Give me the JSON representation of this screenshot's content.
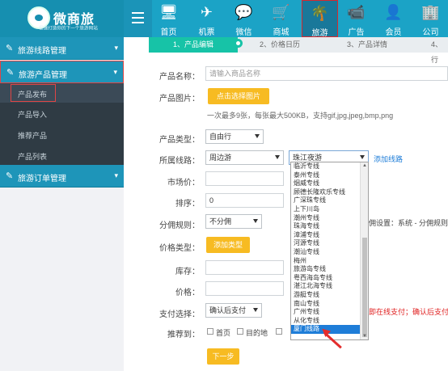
{
  "brand": {
    "name": "微商旅",
    "subtitle": "极速打造你的下一个旅游网站"
  },
  "top_nav": [
    {
      "label": "首页",
      "icon": "monitor-icon"
    },
    {
      "label": "机票",
      "icon": "airplane-icon"
    },
    {
      "label": "微信",
      "icon": "wechat-icon"
    },
    {
      "label": "商城",
      "icon": "cart-icon"
    },
    {
      "label": "旅游",
      "icon": "palm-tree-icon"
    },
    {
      "label": "广告",
      "icon": "video-icon"
    },
    {
      "label": "会员",
      "icon": "member-icon"
    },
    {
      "label": "公司",
      "icon": "company-icon"
    }
  ],
  "sidebar": {
    "groups": [
      {
        "label": "旅游线路管理"
      },
      {
        "label": "旅游产品管理"
      },
      {
        "label": "旅游订单管理"
      }
    ],
    "sub_items": [
      {
        "label": "产品发布"
      },
      {
        "label": "产品导入"
      },
      {
        "label": "推荐产品"
      },
      {
        "label": "产品列表"
      }
    ]
  },
  "steps": [
    {
      "label": "1、产品编辑"
    },
    {
      "label": "2、价格日历"
    },
    {
      "label": "3、产品详情"
    },
    {
      "label": "4、行"
    }
  ],
  "form": {
    "product_name_label": "产品名称：",
    "product_name_placeholder": "请输入商品名称",
    "product_image_label": "产品图片：",
    "choose_image_button": "点击选择图片",
    "image_hint": "一次最多9张，每张最大500KB，支持gif,jpg,jpeg,bmp,png",
    "product_type_label": "产品类型：",
    "product_type_value": "自由行",
    "route_label": "所属线路：",
    "route_select1": "周边游",
    "route_select2": "珠江夜游",
    "add_route_link": "添加线路",
    "market_price_label": "市场价：",
    "sort_label": "排序：",
    "sort_value": "0",
    "commission_label": "分佣规则：",
    "commission_value": "不分佣",
    "commission_hint": "佣设置：系统 - 分佣规则",
    "price_type_label": "价格类型：",
    "add_type_button": "添加类型",
    "stock_label": "库存：",
    "price_label": "价格：",
    "payment_label": "支付选择：",
    "payment_value": "确认后支付",
    "payment_hint": "即在线支付；确认后支付",
    "recommend_label": "推荐到：",
    "recommend_option1": "首页",
    "recommend_option2": "目的地",
    "next_button": "下一步"
  },
  "route_dropdown": [
    "临沂专线",
    "泰州专线",
    "烟威专线",
    "顾德长隆欢乐专线",
    "广深珠专线",
    "上下川岛",
    "潮州专线",
    "珠海专线",
    "漳浦专线",
    "河源专线",
    "潮汕专线",
    "梅州",
    "旅游岛专线",
    "粤西海岛专线",
    "湛江北海专线",
    "游艇专线",
    "南山专线",
    "广州专线",
    "从化专线",
    "厦门线路"
  ],
  "selected_route": "厦门线路"
}
